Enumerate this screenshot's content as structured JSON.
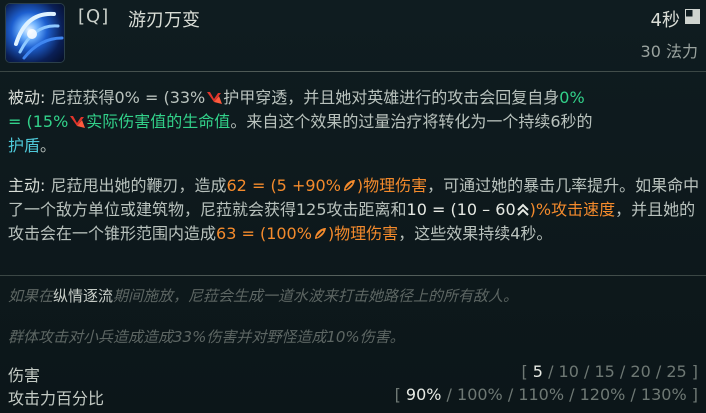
{
  "ability": {
    "key": "[Q]",
    "name": "游刃万变",
    "cooldown": "4秒",
    "cost": "30 法力",
    "icon": "ability-icon"
  },
  "passive": {
    "label": "被动:",
    "t1": " 尼菈获得0% = (33%",
    "t2": "护甲穿透，并且她对英雄进行的攻击会回复自身",
    "heal_a": "0%",
    "heal_b": " = (15%",
    "heal_c": "实际伤害值的生命值",
    "t3": "。来自这个效果的过量治疗将转化为一个持续6秒的",
    "shield": "护盾",
    "t4": "。"
  },
  "active": {
    "label": "主动:",
    "t1": " 尼菈甩出她的鞭刃，造成",
    "dmg_a": "62 = (5  +90%",
    "dmg_b": ")物理伤害",
    "t2": "，可通过她的暴击几率提升。如果命中了一个敌方单位或建筑物，尼菈就会获得125攻击距离和",
    "as_a": "10 = (10 –  60",
    "as_b": ")%攻击速度",
    "t3": "，并且她的攻击会在一个锥形范围内造成",
    "cone_a": "63 = (100%",
    "cone_b": ")物理伤害",
    "t4": "，这些效果持续4秒。"
  },
  "flavor": {
    "line1_a": "如果在",
    "line1_hl": "纵情逐流",
    "line1_b": "期间施放，尼菈会生成一道水波来打击她路径上的所有敌人。",
    "line2": "群体攻击对小兵造成造成33%伤害并对野怪造成10%伤害。"
  },
  "stats": [
    {
      "label": "伤害",
      "open": "[ ",
      "current": "5",
      "rest": " / 10 / 15 / 20 / 25 ]"
    },
    {
      "label": "攻击力百分比",
      "open": "[ ",
      "current": "90%",
      "rest": " / 100% / 110% / 120% / 130% ]"
    }
  ],
  "colors": {
    "background": "#0e1a1e",
    "heal": "#32d18a",
    "shield": "#4ec8d8",
    "physical": "#f38a2c",
    "armor_pen": "#e0342b"
  }
}
